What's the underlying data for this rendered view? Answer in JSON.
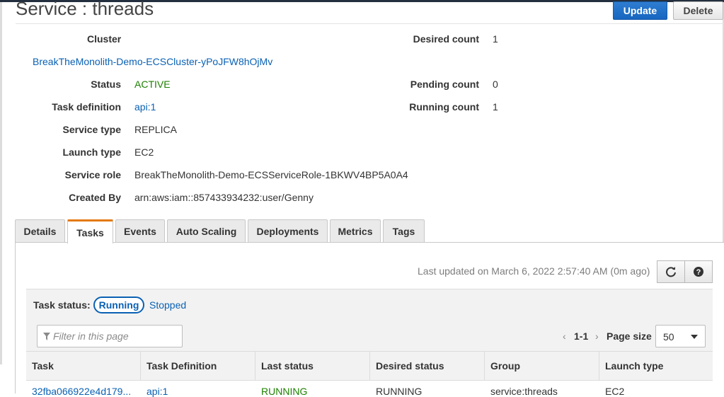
{
  "page": {
    "title": "Service : threads"
  },
  "actions": {
    "update": "Update",
    "delete": "Delete"
  },
  "cluster": {
    "label": "Cluster",
    "value": "BreakTheMonolith-Demo-ECSCluster-yPoJFW8hOjMv"
  },
  "details_left": [
    {
      "label": "Status",
      "value": "ACTIVE",
      "style": "green"
    },
    {
      "label": "Task definition",
      "value": "api:1",
      "style": "link"
    },
    {
      "label": "Service type",
      "value": "REPLICA",
      "style": "plain"
    },
    {
      "label": "Launch type",
      "value": "EC2",
      "style": "plain"
    },
    {
      "label": "Service role",
      "value": "BreakTheMonolith-Demo-ECSServiceRole-1BKWV4BP5A0A4",
      "style": "plain"
    },
    {
      "label": "Created By",
      "value": "arn:aws:iam::857433934232:user/Genny",
      "style": "plain"
    }
  ],
  "details_right": [
    {
      "label": "Desired count",
      "value": "1"
    },
    {
      "label": "Pending count",
      "value": "0"
    },
    {
      "label": "Running count",
      "value": "1"
    }
  ],
  "tabs": [
    "Details",
    "Tasks",
    "Events",
    "Auto Scaling",
    "Deployments",
    "Metrics",
    "Tags"
  ],
  "active_tab": "Tasks",
  "tasks": {
    "last_updated": "Last updated on March 6, 2022 2:57:40 AM (0m ago)",
    "task_status_label": "Task status:",
    "status_running": "Running",
    "status_stopped": "Stopped",
    "filter_placeholder": "Filter in this page",
    "pagination": "1-1",
    "page_size_label": "Page size",
    "page_size": "50",
    "columns": [
      "Task",
      "Task Definition",
      "Last status",
      "Desired status",
      "Group",
      "Launch type"
    ],
    "rows": [
      [
        "32fba066922e4d179...",
        "api:1",
        "RUNNING",
        "RUNNING",
        "service:threads",
        "EC2"
      ]
    ]
  },
  "colors": {
    "link": "#0a61b4",
    "active": "#1d8102",
    "primary_button": "#1766c0",
    "tab_accent": "#e47911"
  },
  "icons": [
    "refresh-icon",
    "help-icon",
    "filter-icon",
    "chevron-left-icon",
    "chevron-right-icon",
    "caret-down-icon"
  ]
}
